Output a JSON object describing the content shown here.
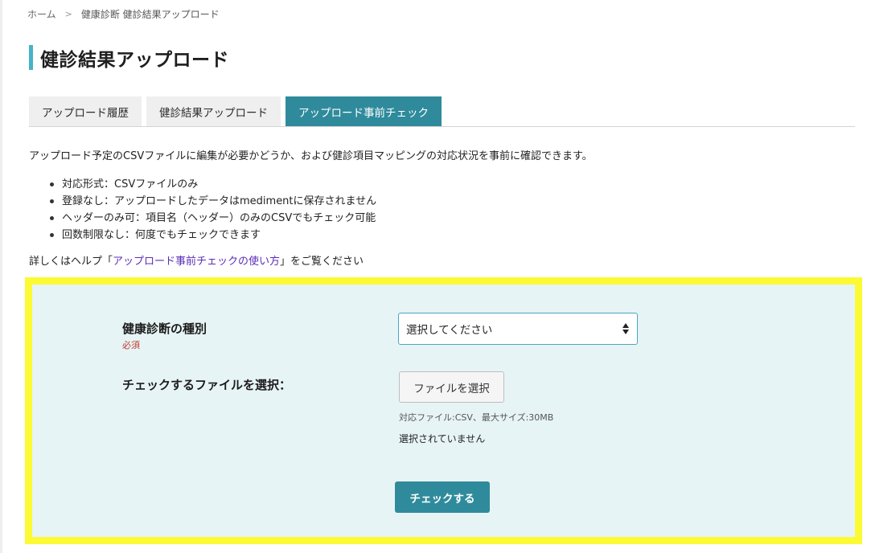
{
  "breadcrumb": {
    "home": "ホーム",
    "separator": ">",
    "current": "健康診断 健診結果アップロード"
  },
  "page_title": "健診結果アップロード",
  "tabs": [
    {
      "label": "アップロード履歴",
      "active": false
    },
    {
      "label": "健診結果アップロード",
      "active": false
    },
    {
      "label": "アップロード事前チェック",
      "active": true
    }
  ],
  "description": "アップロード予定のCSVファイルに編集が必要かどうか、および健診項目マッピングの対応状況を事前に確認できます。",
  "bullets": [
    "対応形式：CSVファイルのみ",
    "登録なし：アップロードしたデータはmedimentに保存されません",
    "ヘッダーのみ可：項目名（ヘッダー）のみのCSVでもチェック可能",
    "回数制限なし：何度でもチェックできます"
  ],
  "help": {
    "prefix": "詳しくはヘルプ「",
    "link": "アップロード事前チェックの使い方",
    "suffix": "」をご覧ください"
  },
  "form": {
    "type_label": "健康診断の種別",
    "required_label": "必須",
    "select_value": "選択してください",
    "file_label": "チェックするファイルを選択：",
    "file_button": "ファイルを選択",
    "file_hint": "対応ファイル:CSV、最大サイズ:30MB",
    "file_status": "選択されていません",
    "submit_label": "チェックする"
  },
  "colors": {
    "accent": "#2f8b9b",
    "title_bar": "#45b3c9",
    "highlight_border": "#fbfa35",
    "form_background": "#e7f4f6",
    "link": "#5b2db8",
    "required": "#c0392b"
  },
  "icons": {
    "breadcrumb_separator": "chevron-right-icon",
    "select_arrow": "sort-arrows-icon"
  }
}
